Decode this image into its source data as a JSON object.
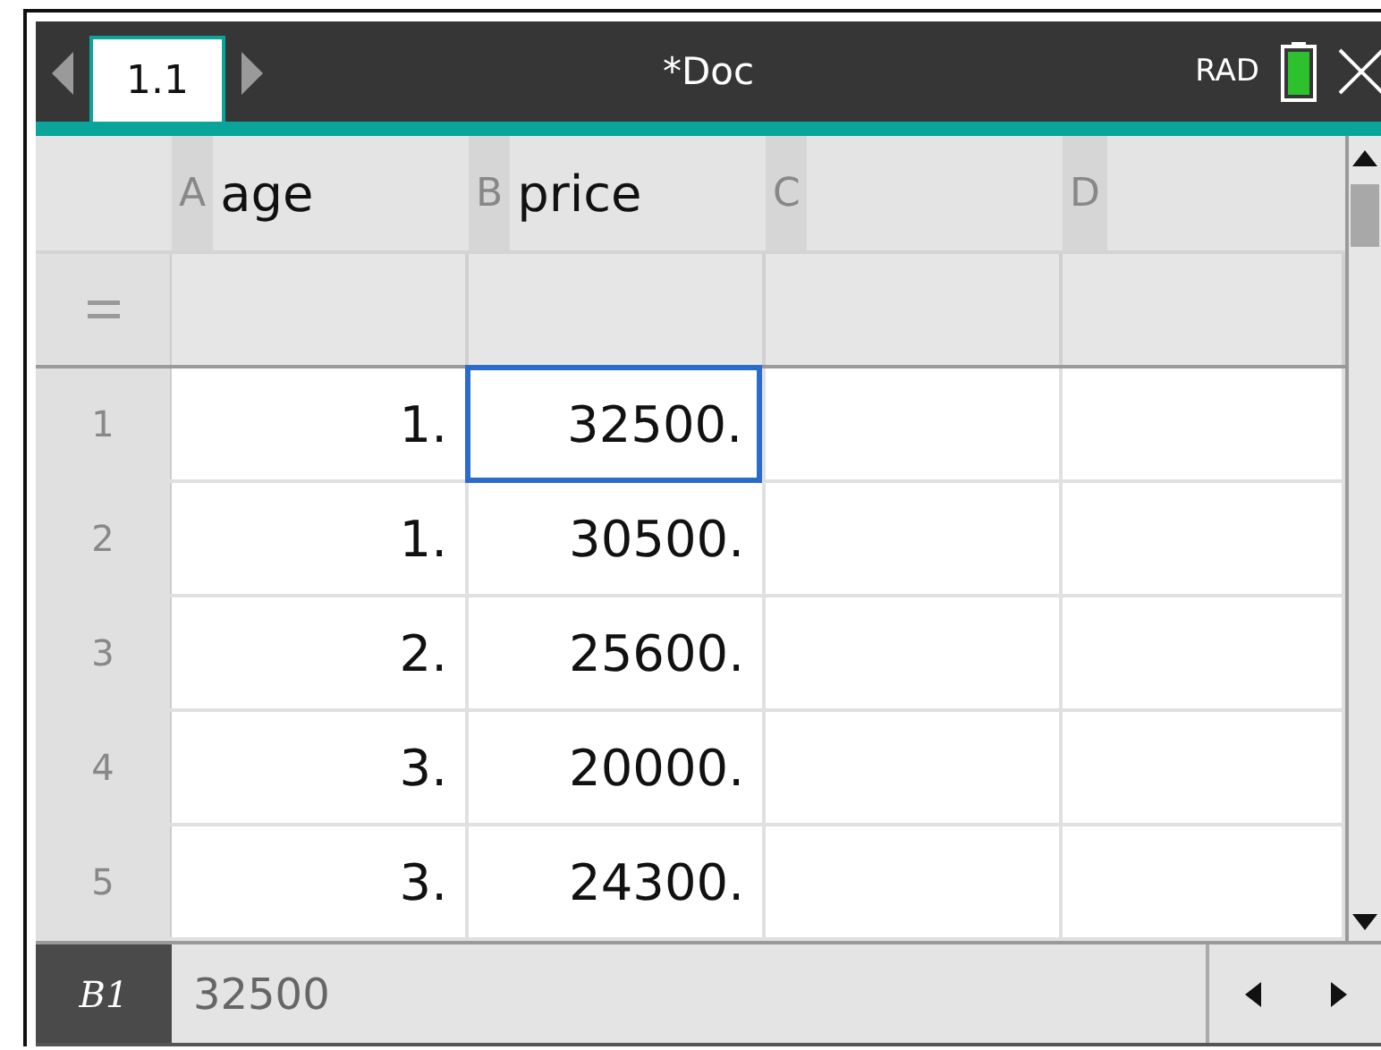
{
  "title_bar": {
    "tabs": [
      {
        "label": "1.1",
        "selected": true
      }
    ],
    "title": "*Doc",
    "mode": "RAD"
  },
  "columns": [
    {
      "letter": "A",
      "name": "age"
    },
    {
      "letter": "B",
      "name": "price"
    },
    {
      "letter": "C"
    },
    {
      "letter": "D"
    }
  ],
  "rows": [
    {
      "number": "1",
      "cells": [
        {
          "value": "1.",
          "selected": false
        },
        {
          "value": "32500.",
          "selected": true
        }
      ]
    },
    {
      "number": "2",
      "cells": [
        {
          "value": "1.",
          "selected": false
        },
        {
          "value": "30500.",
          "selected": false
        }
      ]
    },
    {
      "number": "3",
      "cells": [
        {
          "value": "2.",
          "selected": false
        },
        {
          "value": "25600.",
          "selected": false
        }
      ]
    },
    {
      "number": "4",
      "cells": [
        {
          "value": "3.",
          "selected": false
        },
        {
          "value": "20000.",
          "selected": false
        }
      ]
    },
    {
      "number": "5",
      "cells": [
        {
          "value": "3.",
          "selected": false
        },
        {
          "value": "24300.",
          "selected": false
        }
      ]
    }
  ],
  "status_bar": {
    "cell_ref": "B1",
    "value": "32500"
  }
}
